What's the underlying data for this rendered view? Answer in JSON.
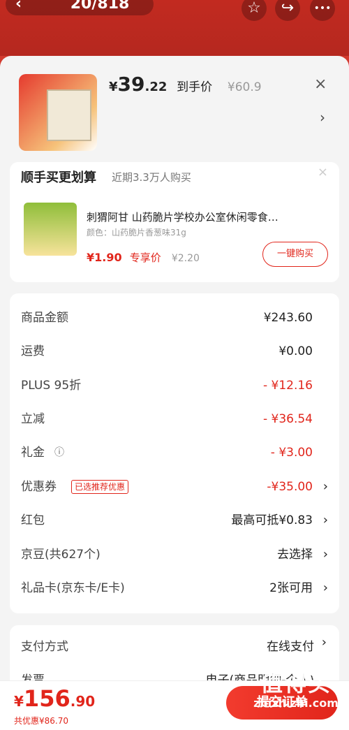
{
  "topbar": {
    "counter": "20/818",
    "back": "‹",
    "star": "☆",
    "share": "↪",
    "more": "•••"
  },
  "product": {
    "price_main": "39",
    "price_dec": ".22",
    "price_label": "到手价",
    "original_price": "¥60.9",
    "currency": "¥",
    "close": "×",
    "chevron": "›"
  },
  "upsell": {
    "title": "顺手买更划算",
    "subtitle": "近期3.3万人购买",
    "close": "×",
    "item_title": "刺猬阿甘 山药脆片学校办公室休闲零食…",
    "item_variant": "颜色：山药脆片香葱味31g",
    "item_price": "¥1.90",
    "item_price_label": "专享价",
    "item_orig_price": "¥2.20",
    "buy_button": "一键购买"
  },
  "summary": [
    {
      "label": "商品金额",
      "value": "¥243.60",
      "red": false,
      "arrow": ""
    },
    {
      "label": "运费",
      "value": "¥0.00",
      "red": false,
      "arrow": ""
    },
    {
      "label": "PLUS  95折",
      "value": "- ¥12.16",
      "red": true,
      "arrow": ""
    },
    {
      "label": "立减",
      "value": "- ¥36.54",
      "red": true,
      "arrow": ""
    },
    {
      "label": "礼金",
      "value": "- ¥3.00",
      "red": true,
      "arrow": ""
    },
    {
      "label": "优惠券",
      "value": "-¥35.00",
      "red": true,
      "arrow": "›",
      "tag": "已选推荐优惠"
    },
    {
      "label": "红包",
      "value": "最高可抵¥0.83",
      "red": false,
      "arrow": "›"
    },
    {
      "label": "京豆(共627个)",
      "value": "去选择",
      "red": false,
      "arrow": "›"
    },
    {
      "label": "礼品卡(京东卡/E卡)",
      "value": "2张可用",
      "red": false,
      "arrow": "›"
    }
  ],
  "payment": {
    "method_label": "支付方式",
    "method_value": "在线支付",
    "invoice_label": "发票",
    "invoice_value": "电子(商品明细-个人)"
  },
  "footer": {
    "total_currency": "¥",
    "total_main": "156",
    "total_dec": ".90",
    "discount": "共优惠¥86.70",
    "submit": "提交订单"
  },
  "watermark": {
    "line1": "值得买",
    "line2": "zhizhizhi.com"
  },
  "colors": {
    "accent": "#e1251b"
  }
}
